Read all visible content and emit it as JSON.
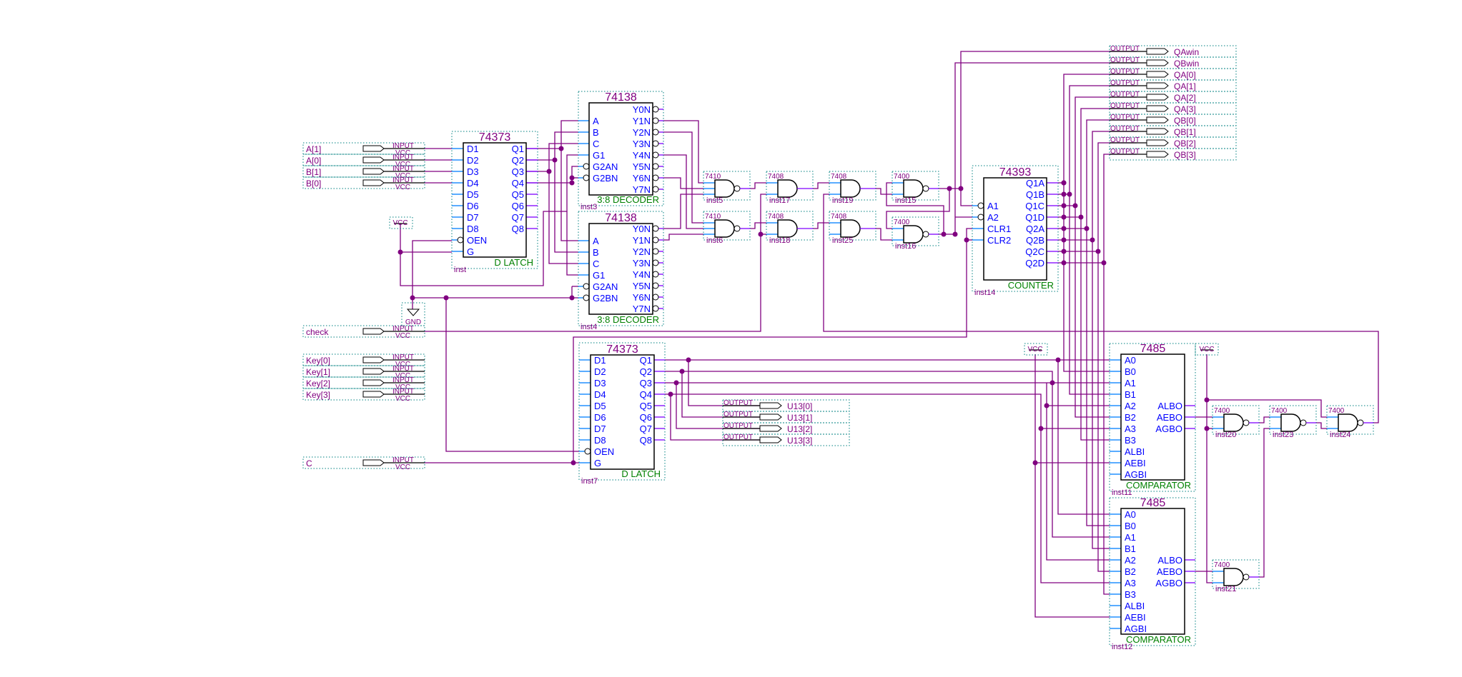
{
  "labels": {
    "input": "INPUT",
    "output": "OUTPUT",
    "vcc": "VCC",
    "gnd": "GND"
  },
  "inputs": [
    {
      "name": "A[1]"
    },
    {
      "name": "A[0]"
    },
    {
      "name": "B[1]"
    },
    {
      "name": "B[0]"
    },
    {
      "name": "check"
    },
    {
      "name": "Key[0]"
    },
    {
      "name": "Key[1]"
    },
    {
      "name": "Key[2]"
    },
    {
      "name": "Key[3]"
    },
    {
      "name": "C"
    }
  ],
  "outputs": [
    {
      "name": "QAwin"
    },
    {
      "name": "QBwin"
    },
    {
      "name": "QA[0]"
    },
    {
      "name": "QA[1]"
    },
    {
      "name": "QA[2]"
    },
    {
      "name": "QA[3]"
    },
    {
      "name": "QB[0]"
    },
    {
      "name": "QB[1]"
    },
    {
      "name": "QB[2]"
    },
    {
      "name": "QB[3]"
    },
    {
      "name": "U13[0]"
    },
    {
      "name": "U13[1]"
    },
    {
      "name": "U13[2]"
    },
    {
      "name": "U13[3]"
    }
  ],
  "components": {
    "latch1": {
      "part": "74373",
      "inst": "inst",
      "desc": "D LATCH",
      "left": [
        "D1",
        "D2",
        "D3",
        "D4",
        "D5",
        "D6",
        "D7",
        "D8",
        "OEN",
        "G"
      ],
      "right": [
        "Q1",
        "Q2",
        "Q3",
        "Q4",
        "Q5",
        "Q6",
        "Q7",
        "Q8"
      ]
    },
    "dec1": {
      "part": "74138",
      "inst": "inst3",
      "desc": "3:8 DECODER",
      "left": [
        "A",
        "B",
        "C",
        "G1",
        "G2AN",
        "G2BN"
      ],
      "right": [
        "Y0N",
        "Y1N",
        "Y2N",
        "Y3N",
        "Y4N",
        "Y5N",
        "Y6N",
        "Y7N"
      ]
    },
    "dec2": {
      "part": "74138",
      "inst": "inst4",
      "desc": "3:8 DECODER",
      "left": [
        "A",
        "B",
        "C",
        "G1",
        "G2AN",
        "G2BN"
      ],
      "right": [
        "Y0N",
        "Y1N",
        "Y2N",
        "Y3N",
        "Y4N",
        "Y5N",
        "Y6N",
        "Y7N"
      ]
    },
    "latch2": {
      "part": "74373",
      "inst": "inst7",
      "desc": "D LATCH",
      "left": [
        "D1",
        "D2",
        "D3",
        "D4",
        "D5",
        "D6",
        "D7",
        "D8",
        "OEN",
        "G"
      ],
      "right": [
        "Q1",
        "Q2",
        "Q3",
        "Q4",
        "Q5",
        "Q6",
        "Q7",
        "Q8"
      ]
    },
    "counter": {
      "part": "74393",
      "inst": "inst14",
      "desc": "COUNTER",
      "left": [
        "A1",
        "A2",
        "CLR1",
        "CLR2"
      ],
      "right": [
        "Q1A",
        "Q1B",
        "Q1C",
        "Q1D",
        "Q2A",
        "Q2B",
        "Q2C",
        "Q2D"
      ]
    },
    "comp1": {
      "part": "7485",
      "inst": "inst11",
      "desc": "COMPARATOR",
      "left": [
        "A0",
        "B0",
        "A1",
        "B1",
        "A2",
        "B2",
        "A3",
        "B3",
        "ALBI",
        "AEBI",
        "AGBI"
      ],
      "right": [
        "ALBO",
        "AEBO",
        "AGBO"
      ]
    },
    "comp2": {
      "part": "7485",
      "inst": "inst12",
      "desc": "COMPARATOR",
      "left": [
        "A0",
        "B0",
        "A1",
        "B1",
        "A2",
        "B2",
        "A3",
        "B3",
        "ALBI",
        "AEBI",
        "AGBI"
      ],
      "right": [
        "ALBO",
        "AEBO",
        "AGBO"
      ]
    }
  },
  "gates": [
    {
      "part": "7410",
      "inst": "inst5",
      "type": "nand3"
    },
    {
      "part": "7410",
      "inst": "inst6",
      "type": "nand3"
    },
    {
      "part": "7408",
      "inst": "inst17",
      "type": "and2"
    },
    {
      "part": "7408",
      "inst": "inst18",
      "type": "and2"
    },
    {
      "part": "7408",
      "inst": "inst19",
      "type": "and2"
    },
    {
      "part": "7408",
      "inst": "inst25",
      "type": "and2"
    },
    {
      "part": "7400",
      "inst": "inst15",
      "type": "nand2"
    },
    {
      "part": "7400",
      "inst": "inst16",
      "type": "nand2"
    },
    {
      "part": "7400",
      "inst": "inst20",
      "type": "nand2"
    },
    {
      "part": "7400",
      "inst": "inst23",
      "type": "nand2"
    },
    {
      "part": "7400",
      "inst": "inst24",
      "type": "nand2"
    },
    {
      "part": "7400",
      "inst": "inst21",
      "type": "nand2"
    }
  ],
  "colors": {
    "wire": "#800080",
    "frame": "#008080",
    "pin_text": "#0000ff",
    "description": "#008000",
    "pin_stub": "#0080ff"
  }
}
